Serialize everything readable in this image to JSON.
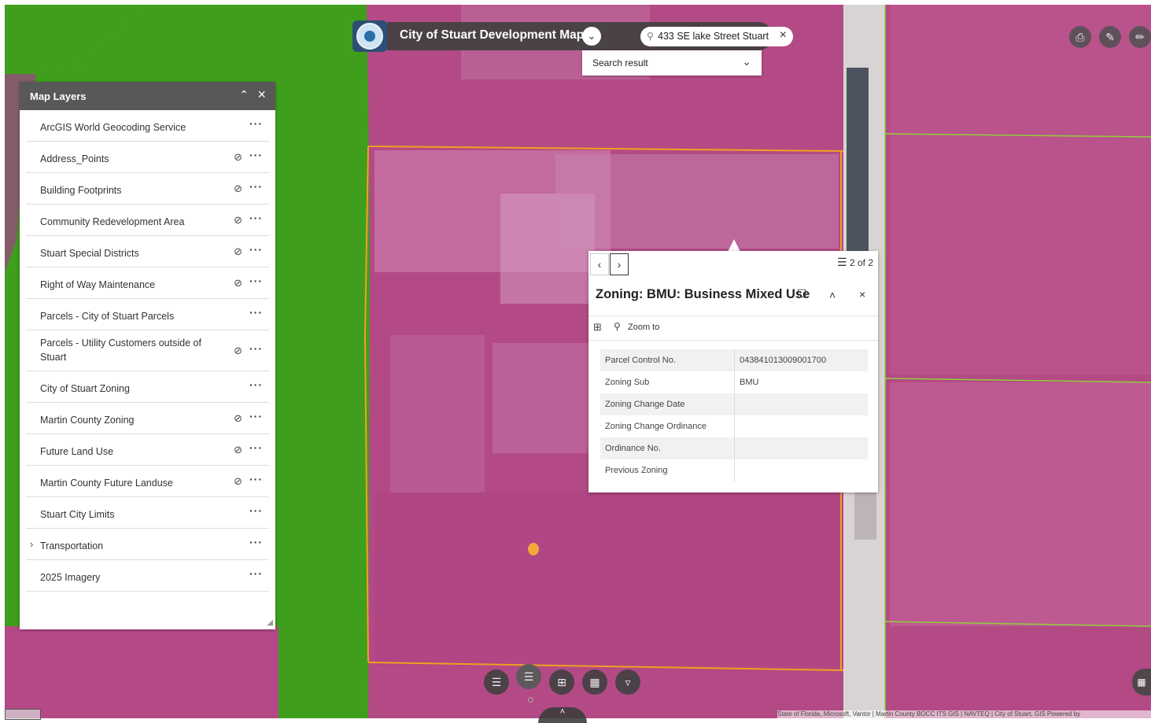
{
  "header": {
    "title": "City of Stuart Development Map",
    "search_value": "433 SE lake Street Stuart",
    "search_result_label": "Search result"
  },
  "icons": {
    "logo": "city-seal-icon",
    "title_dropdown": "chevron-down-icon",
    "search": "search-icon",
    "clear": "close-icon",
    "print": "print-icon",
    "measure": "ruler-icon",
    "draw": "pencil-icon"
  },
  "layers_panel": {
    "title": "Map Layers",
    "layers": [
      {
        "label": "ArcGIS World Geocoding Service",
        "hidden": false,
        "expandable": false
      },
      {
        "label": "Address_Points",
        "hidden": true,
        "expandable": false
      },
      {
        "label": "Building Footprints",
        "hidden": true,
        "expandable": false
      },
      {
        "label": "Community Redevelopment Area",
        "hidden": true,
        "expandable": false
      },
      {
        "label": "Stuart Special Districts",
        "hidden": true,
        "expandable": false
      },
      {
        "label": "Right of Way Maintenance",
        "hidden": true,
        "expandable": false
      },
      {
        "label": "Parcels - City of Stuart Parcels",
        "hidden": false,
        "expandable": false
      },
      {
        "label": "Parcels - Utility Customers outside of Stuart",
        "hidden": true,
        "expandable": false
      },
      {
        "label": "City of Stuart Zoning",
        "hidden": false,
        "expandable": false
      },
      {
        "label": "Martin County Zoning",
        "hidden": true,
        "expandable": false
      },
      {
        "label": "Future Land Use",
        "hidden": true,
        "expandable": false
      },
      {
        "label": "Martin County Future Landuse",
        "hidden": true,
        "expandable": false
      },
      {
        "label": "Stuart City Limits",
        "hidden": false,
        "expandable": false
      },
      {
        "label": "Transportation",
        "hidden": false,
        "expandable": true
      },
      {
        "label": "2025 Imagery",
        "hidden": false,
        "expandable": false
      }
    ]
  },
  "popup": {
    "page_indicator": "2 of 2",
    "title": "Zoning: BMU: Business Mixed Use",
    "zoom_label": "Zoom to",
    "attributes": [
      {
        "field": "Parcel Control No.",
        "value": "043841013009001700"
      },
      {
        "field": "Zoning Sub",
        "value": "BMU"
      },
      {
        "field": "Zoning Change Date",
        "value": ""
      },
      {
        "field": "Zoning Change Ordinance",
        "value": ""
      },
      {
        "field": "Ordinance No.",
        "value": ""
      },
      {
        "field": "Previous Zoning",
        "value": ""
      }
    ]
  },
  "bottom_toolbar": [
    "list-icon",
    "layers-icon",
    "basemap-grid-icon",
    "select-icon",
    "filter-icon"
  ],
  "attribution": "State of Florida, Microsoft, Vantor | Martin County BOCC ITS GIS | NAVTEQ | City of Stuart, GIS   Powered by",
  "colors": {
    "zoning_bmu": "#b0447f",
    "open_space": "#3f9f1c",
    "parcel_line": "#f0a020",
    "selected_point": "#f2a93b",
    "header_bg": "#404040"
  }
}
